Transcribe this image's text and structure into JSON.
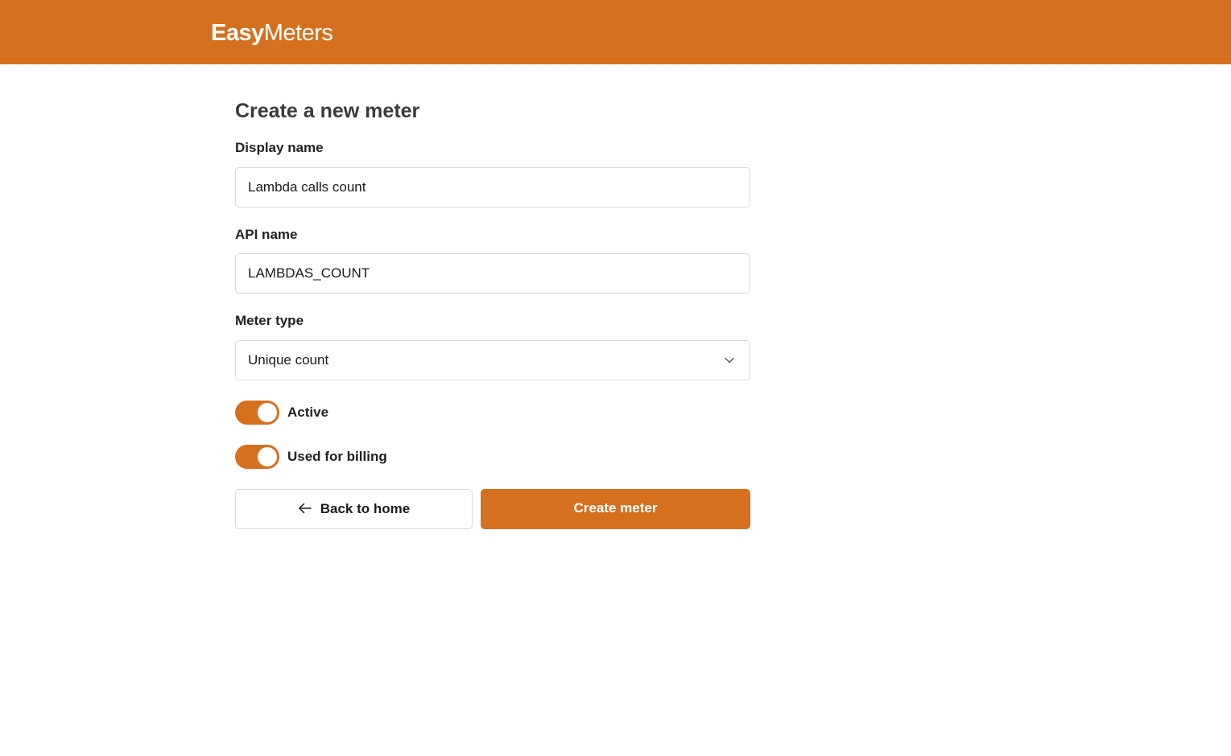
{
  "brand": {
    "name_bold": "Easy",
    "name_light": "Meters",
    "color": "#d5701f"
  },
  "form": {
    "title": "Create a new meter",
    "display_name": {
      "label": "Display name",
      "value": "Lambda calls count"
    },
    "api_name": {
      "label": "API name",
      "value": "LAMBDAS_COUNT"
    },
    "meter_type": {
      "label": "Meter type",
      "selected": "Unique count",
      "icon": "chevron-down-icon"
    },
    "toggles": [
      {
        "label": "Active",
        "on": true
      },
      {
        "label": "Used for billing",
        "on": true
      }
    ],
    "back_button": {
      "label": "Back to home",
      "icon": "arrow-left-icon"
    },
    "submit_button": {
      "label": "Create meter"
    }
  }
}
